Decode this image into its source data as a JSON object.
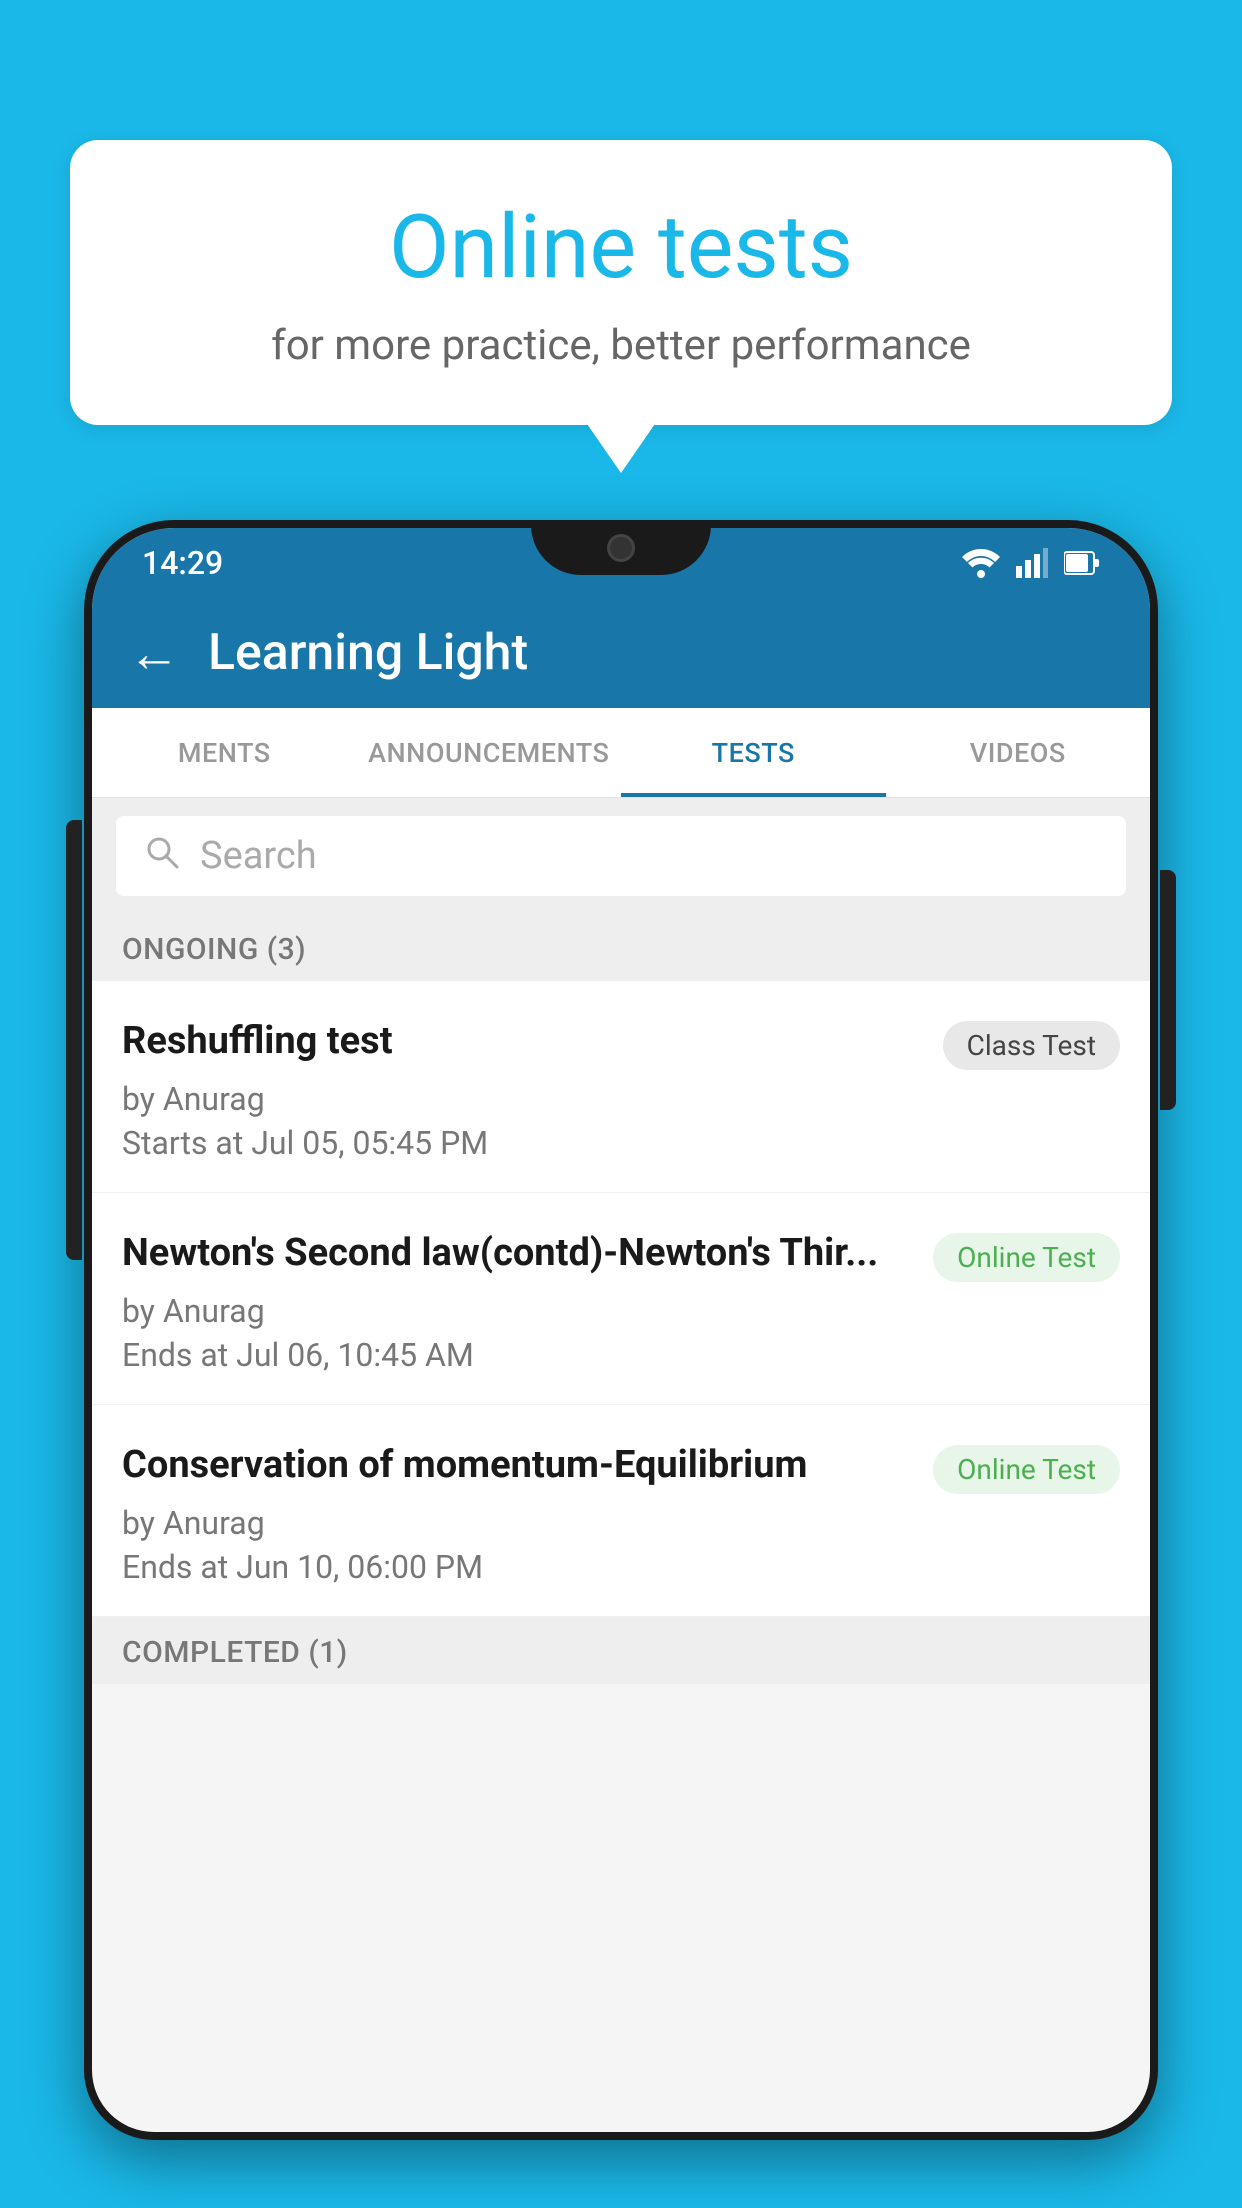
{
  "background_color": "#1ab8e8",
  "bubble": {
    "title": "Online tests",
    "subtitle": "for more practice, better performance"
  },
  "phone": {
    "status_bar": {
      "time": "14:29",
      "icons": [
        "wifi",
        "signal",
        "battery"
      ]
    },
    "app_bar": {
      "title": "Learning Light",
      "back_label": "←"
    },
    "tabs": [
      {
        "label": "MENTS",
        "active": false
      },
      {
        "label": "ANNOUNCEMENTS",
        "active": false
      },
      {
        "label": "TESTS",
        "active": true
      },
      {
        "label": "VIDEOS",
        "active": false
      }
    ],
    "search": {
      "placeholder": "Search"
    },
    "ongoing_section": {
      "label": "ONGOING (3)"
    },
    "tests": [
      {
        "name": "Reshuffling test",
        "badge": "Class Test",
        "badge_type": "class",
        "author": "by Anurag",
        "date_label": "Starts at",
        "date": "Jul 05, 05:45 PM"
      },
      {
        "name": "Newton's Second law(contd)-Newton's Thir...",
        "badge": "Online Test",
        "badge_type": "online",
        "author": "by Anurag",
        "date_label": "Ends at",
        "date": "Jul 06, 10:45 AM"
      },
      {
        "name": "Conservation of momentum-Equilibrium",
        "badge": "Online Test",
        "badge_type": "online",
        "author": "by Anurag",
        "date_label": "Ends at",
        "date": "Jun 10, 06:00 PM"
      }
    ],
    "completed_section": {
      "label": "COMPLETED (1)"
    }
  }
}
